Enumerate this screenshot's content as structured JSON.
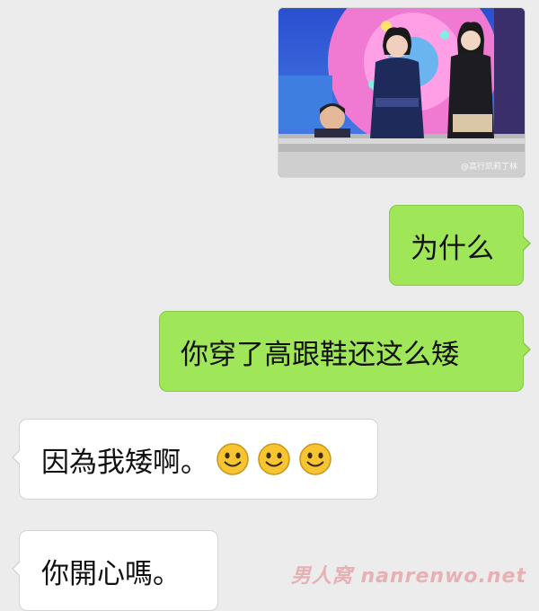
{
  "messages": [
    {
      "direction": "outgoing",
      "type": "image",
      "watermark": "@高行凯莉丁林"
    },
    {
      "direction": "outgoing",
      "type": "text",
      "text": "为什么"
    },
    {
      "direction": "outgoing",
      "type": "text",
      "text": "你穿了高跟鞋还这么矮"
    },
    {
      "direction": "incoming",
      "type": "text",
      "text": "因為我矮啊。",
      "emoji": [
        "smile-emoji",
        "smile-emoji",
        "smile-emoji"
      ]
    },
    {
      "direction": "incoming",
      "type": "text",
      "text": "你開心嗎。"
    }
  ],
  "watermark": "男人窝 nanrenwo.net",
  "colors": {
    "background": "#ececec",
    "outgoing_bubble": "#9fe658",
    "incoming_bubble": "#ffffff"
  }
}
